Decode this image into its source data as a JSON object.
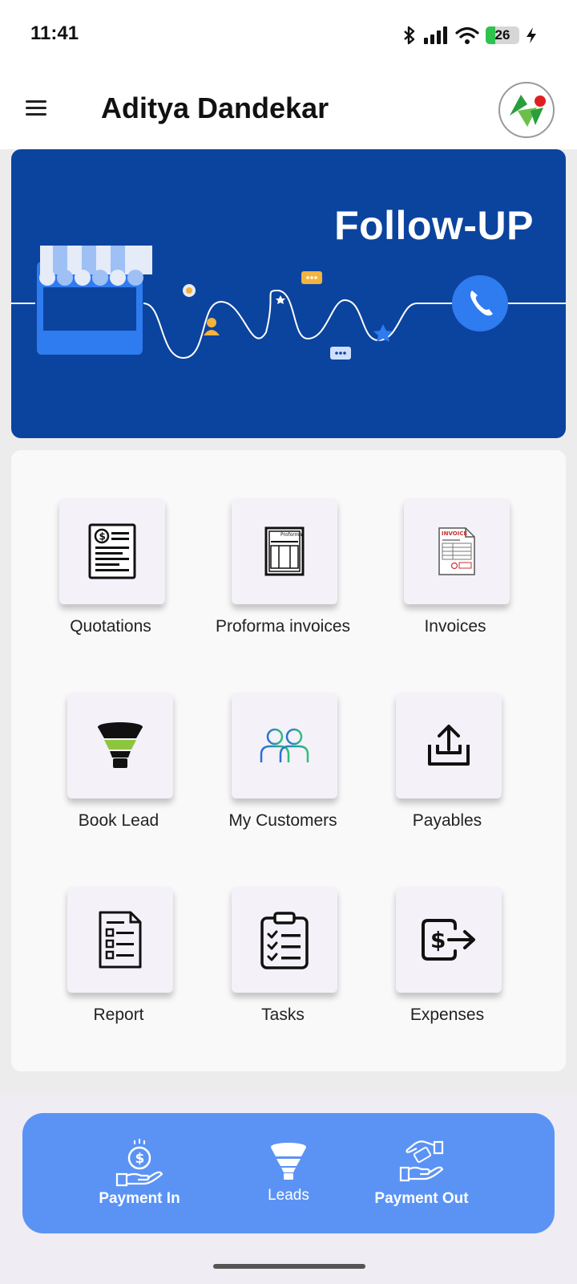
{
  "status_bar": {
    "time": "11:41",
    "battery_level": "26",
    "icons": [
      "bluetooth-icon",
      "signal-icon",
      "wifi-icon",
      "battery-icon",
      "charging-icon"
    ]
  },
  "app_bar": {
    "title": "Aditya Dandekar",
    "menu_icon": "hamburger-menu-icon",
    "logo": "company-logo"
  },
  "banner": {
    "title": "Follow-UP",
    "background": "#0b449e"
  },
  "grid": {
    "items": [
      {
        "label": "Quotations",
        "icon": "quotation-document-icon"
      },
      {
        "label": "Proforma invoices",
        "icon": "proforma-document-icon"
      },
      {
        "label": "Invoices",
        "icon": "invoice-document-icon"
      },
      {
        "label": "Book Lead",
        "icon": "funnel-icon"
      },
      {
        "label": "My Customers",
        "icon": "customers-icon"
      },
      {
        "label": "Payables",
        "icon": "upload-tray-icon"
      },
      {
        "label": "Report",
        "icon": "report-icon"
      },
      {
        "label": "Tasks",
        "icon": "clipboard-checklist-icon"
      },
      {
        "label": "Expenses",
        "icon": "money-out-icon"
      }
    ]
  },
  "bottom_nav": {
    "background": "#5b93f5",
    "items": [
      {
        "label": "Payment In",
        "icon": "hand-coin-icon"
      },
      {
        "label": "Leads",
        "icon": "funnel-icon"
      },
      {
        "label": "Payment Out",
        "icon": "handshake-money-icon"
      }
    ]
  }
}
